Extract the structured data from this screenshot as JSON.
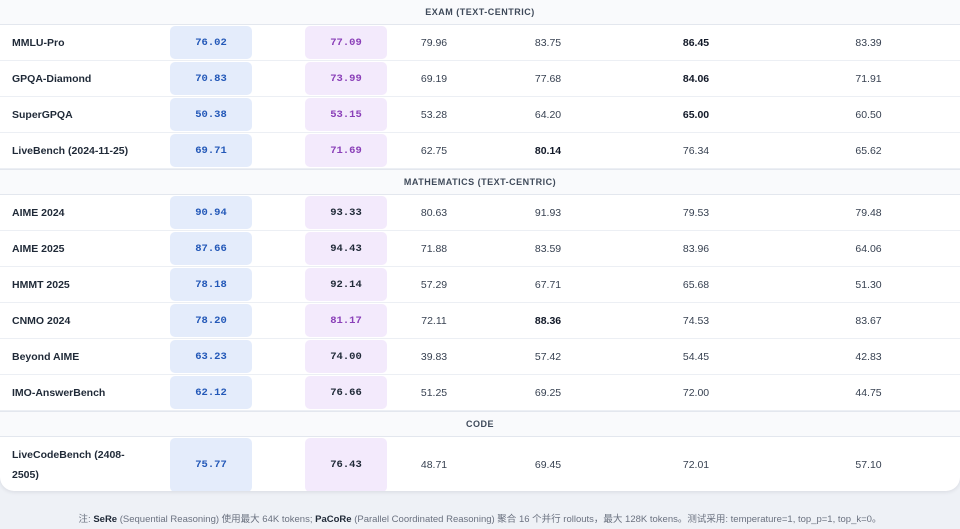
{
  "sections": [
    {
      "title": "EXAM (TEXT-CENTRIC)",
      "rows": [
        {
          "name": "MMLU-Pro",
          "sere": "76.02",
          "pacore": "77.09",
          "pacore_dark": false,
          "v1": "79.96",
          "v2": "83.75",
          "v3": "86.45",
          "v4": "83.39",
          "bold": [
            false,
            false,
            true,
            false
          ]
        },
        {
          "name": "GPQA-Diamond",
          "sere": "70.83",
          "pacore": "73.99",
          "pacore_dark": false,
          "v1": "69.19",
          "v2": "77.68",
          "v3": "84.06",
          "v4": "71.91",
          "bold": [
            false,
            false,
            true,
            false
          ]
        },
        {
          "name": "SuperGPQA",
          "sere": "50.38",
          "pacore": "53.15",
          "pacore_dark": false,
          "v1": "53.28",
          "v2": "64.20",
          "v3": "65.00",
          "v4": "60.50",
          "bold": [
            false,
            false,
            true,
            false
          ]
        },
        {
          "name": "LiveBench (2024-11-25)",
          "sere": "69.71",
          "pacore": "71.69",
          "pacore_dark": false,
          "v1": "62.75",
          "v2": "80.14",
          "v3": "76.34",
          "v4": "65.62",
          "bold": [
            false,
            true,
            false,
            false
          ]
        }
      ]
    },
    {
      "title": "MATHEMATICS (TEXT-CENTRIC)",
      "rows": [
        {
          "name": "AIME 2024",
          "sere": "90.94",
          "pacore": "93.33",
          "pacore_dark": true,
          "v1": "80.63",
          "v2": "91.93",
          "v3": "79.53",
          "v4": "79.48",
          "bold": [
            false,
            false,
            false,
            false
          ]
        },
        {
          "name": "AIME 2025",
          "sere": "87.66",
          "pacore": "94.43",
          "pacore_dark": true,
          "v1": "71.88",
          "v2": "83.59",
          "v3": "83.96",
          "v4": "64.06",
          "bold": [
            false,
            false,
            false,
            false
          ]
        },
        {
          "name": "HMMT 2025",
          "sere": "78.18",
          "pacore": "92.14",
          "pacore_dark": true,
          "v1": "57.29",
          "v2": "67.71",
          "v3": "65.68",
          "v4": "51.30",
          "bold": [
            false,
            false,
            false,
            false
          ]
        },
        {
          "name": "CNMO 2024",
          "sere": "78.20",
          "pacore": "81.17",
          "pacore_dark": false,
          "v1": "72.11",
          "v2": "88.36",
          "v3": "74.53",
          "v4": "83.67",
          "bold": [
            false,
            true,
            false,
            false
          ]
        },
        {
          "name": "Beyond AIME",
          "sere": "63.23",
          "pacore": "74.00",
          "pacore_dark": true,
          "v1": "39.83",
          "v2": "57.42",
          "v3": "54.45",
          "v4": "42.83",
          "bold": [
            false,
            false,
            false,
            false
          ]
        },
        {
          "name": "IMO-AnswerBench",
          "sere": "62.12",
          "pacore": "76.66",
          "pacore_dark": true,
          "v1": "51.25",
          "v2": "69.25",
          "v3": "72.00",
          "v4": "44.75",
          "bold": [
            false,
            false,
            false,
            false
          ]
        }
      ]
    },
    {
      "title": "CODE",
      "rows": [
        {
          "name_line1": "LiveCodeBench (2408-",
          "name_line2": "2505)",
          "sere": "75.77",
          "pacore": "76.43",
          "pacore_dark": true,
          "v1": "48.71",
          "v2": "69.45",
          "v3": "72.01",
          "v4": "57.10",
          "bold": [
            false,
            false,
            false,
            false
          ]
        }
      ]
    }
  ],
  "footnote": {
    "prefix": "注: ",
    "sere_label": "SeRe",
    "sere_text": " (Sequential Reasoning) 使用最大 64K tokens; ",
    "pacore_label": "PaCoRe",
    "pacore_text": " (Parallel Coordinated Reasoning) 聚合 16 个并行 rollouts，最大 128K tokens。测试采用: temperature=1, top_p=1, top_k=0。"
  },
  "colors": {
    "sere_bg": "#e4ecfb",
    "sere_text": "#2358b8",
    "pacore_bg": "#f3eafc",
    "pacore_text": "#8a3fb8"
  }
}
